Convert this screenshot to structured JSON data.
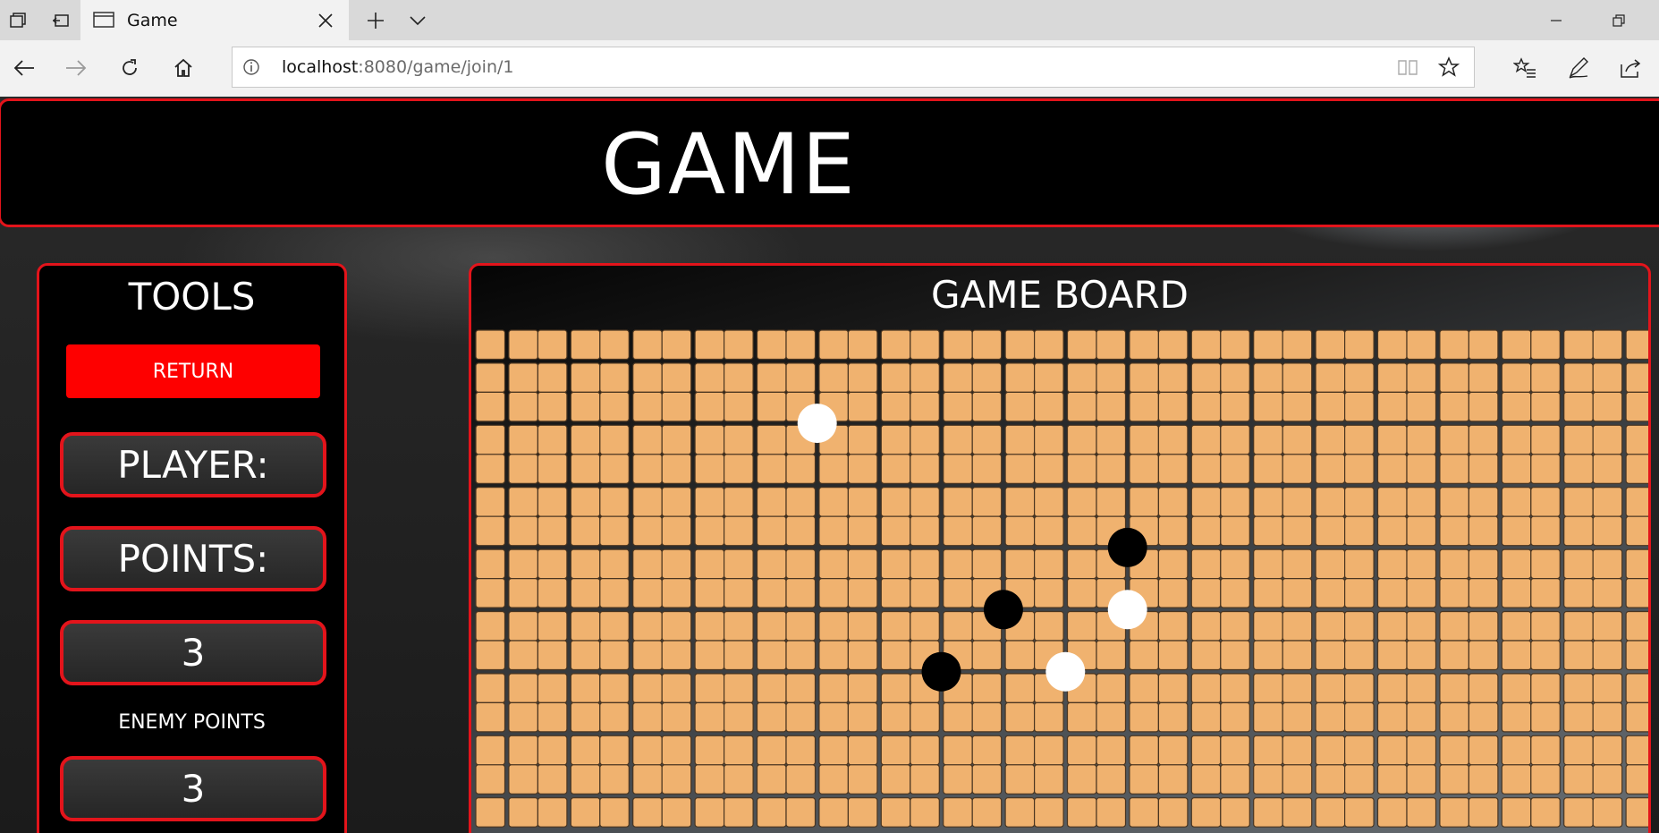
{
  "browser": {
    "tab_title": "Game",
    "url_host": "localhost",
    "url_rest": ":8080/game/join/1"
  },
  "header": {
    "title": "GAME"
  },
  "tools": {
    "title": "TOOLS",
    "return_label": "RETURN",
    "player_label": "PLAYER:",
    "points_label": "POINTS:",
    "player_points": "3",
    "enemy_points_label": "ENEMY POINTS",
    "enemy_points": "3"
  },
  "board": {
    "title": "GAME BOARD",
    "columns": 19,
    "visible_rows": 8,
    "cell_color": "#f0b26f",
    "stones": [
      {
        "color": "white",
        "col": 5,
        "row": 1
      },
      {
        "color": "black",
        "col": 10,
        "row": 3
      },
      {
        "color": "black",
        "col": 8,
        "row": 4
      },
      {
        "color": "white",
        "col": 10,
        "row": 4
      },
      {
        "color": "black",
        "col": 7,
        "row": 5
      },
      {
        "color": "white",
        "col": 9,
        "row": 5
      }
    ]
  },
  "colors": {
    "accent_red": "#e3141b",
    "return_button": "#fe0000"
  }
}
